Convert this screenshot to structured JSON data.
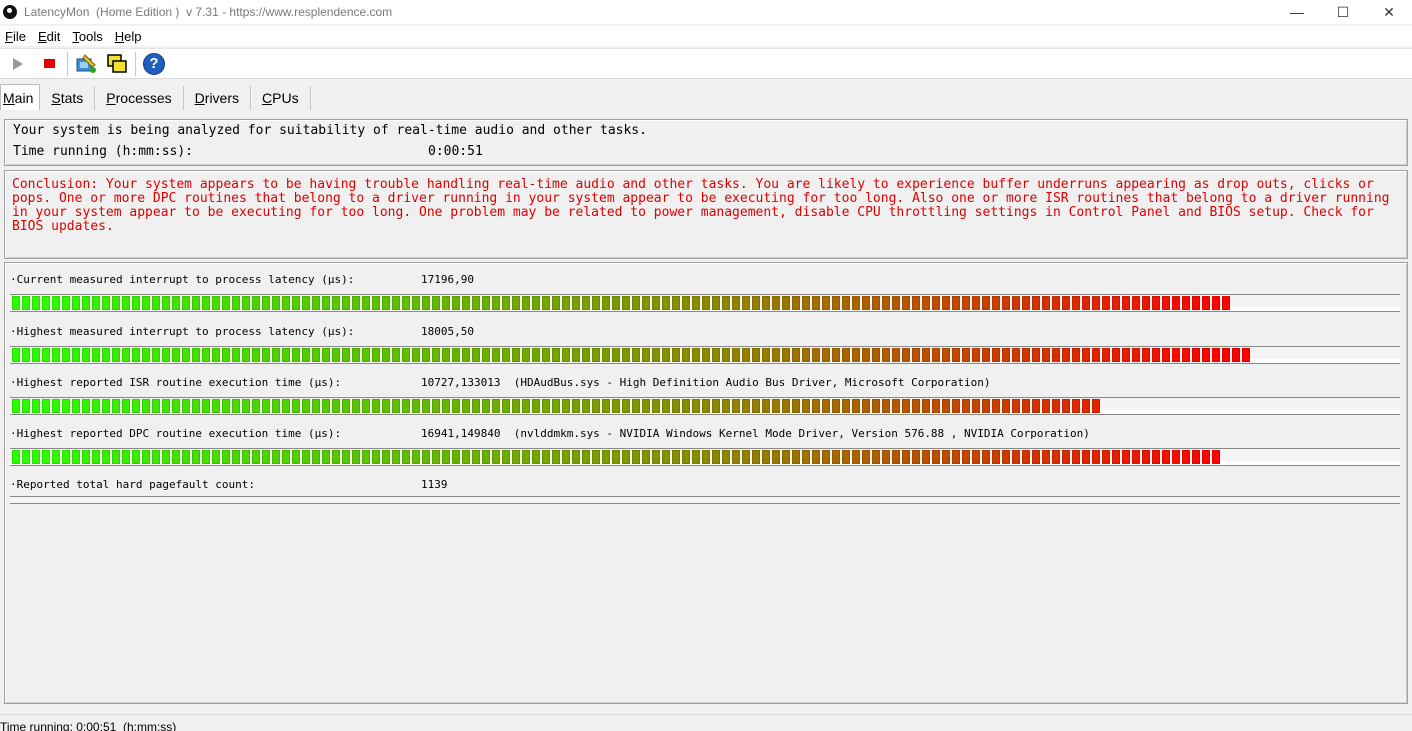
{
  "window": {
    "title": "LatencyMon  (Home Edition )  v 7.31 - https://www.resplendence.com",
    "minimize_glyph": "—",
    "maximize_glyph": "☐",
    "close_glyph": "✕"
  },
  "menu": {
    "items": [
      {
        "underline": "F",
        "rest": "ile"
      },
      {
        "underline": "E",
        "rest": "dit"
      },
      {
        "underline": "T",
        "rest": "ools"
      },
      {
        "underline": "H",
        "rest": "elp"
      }
    ]
  },
  "toolbar": {
    "icons": [
      "play-icon",
      "stop-icon",
      "driver-icon",
      "windows-icon",
      "help-icon"
    ],
    "help_glyph": "?"
  },
  "tabs": [
    {
      "underline": "M",
      "rest": "ain"
    },
    {
      "underline": "S",
      "rest": "tats"
    },
    {
      "underline": "P",
      "rest": "rocesses"
    },
    {
      "underline": "D",
      "rest": "rivers"
    },
    {
      "underline": "C",
      "rest": "PUs"
    }
  ],
  "info": {
    "analyzing": "Your system is being analyzed for suitability of real-time audio and other tasks.",
    "time_label": "Time running (h:mm:ss):",
    "time_value": "0:00:51"
  },
  "conclusion": "Conclusion: Your system appears to be having trouble handling real-time audio and other tasks. You are likely to experience buffer underruns appearing as drop outs, clicks or pops. One or more DPC routines that belong to a driver running in your system appear to be executing for too long. Also one or more ISR routines that belong to a driver running in your system appear to be executing for too long. One problem may be related to power management, disable CPU throttling settings in Control Panel and BIOS setup. Check for BIOS updates.",
  "metrics": [
    {
      "label": "·Current measured interrupt to process latency (µs):",
      "value": "17196,90",
      "segments": 122
    },
    {
      "label": "·Highest measured interrupt to process latency (µs):",
      "value": "18005,50",
      "segments": 124
    },
    {
      "label": "·Highest reported ISR routine execution time (µs):",
      "value": "10727,133013  (HDAudBus.sys - High Definition Audio Bus Driver, Microsoft Corporation)",
      "segments": 109
    },
    {
      "label": "·Highest reported DPC routine execution time (µs):",
      "value": "16941,149840  (nvlddmkm.sys - NVIDIA Windows Kernel Mode Driver, Version 576.88 , NVIDIA Corporation)",
      "segments": 121
    },
    {
      "label": "·Reported total hard pagefault count:",
      "value": "1139",
      "segments": 0
    }
  ],
  "colors": {
    "bar_start": "#2aff00",
    "bar_mid": "#8a8a00",
    "bar_end": "#ff0000",
    "conclusion_text": "#e00000"
  },
  "status": "Time running: 0:00:51  (h:mm:ss)"
}
